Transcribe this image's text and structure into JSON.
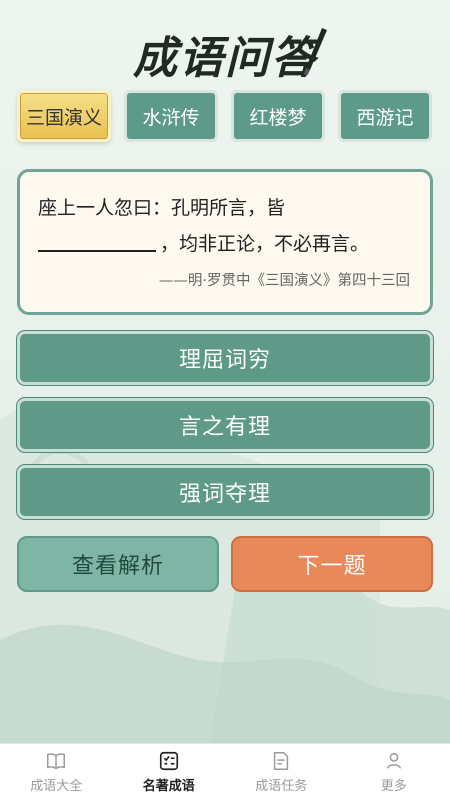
{
  "app": {
    "title": "成语问答"
  },
  "tabs": [
    {
      "label": "三国演义",
      "active": true
    },
    {
      "label": "水浒传",
      "active": false
    },
    {
      "label": "红楼梦",
      "active": false
    },
    {
      "label": "西游记",
      "active": false
    }
  ],
  "question": {
    "line1": "座上一人忽曰：孔明所言，皆",
    "line2_after_blank": "，均非正论，不必再言。",
    "source": "——明·罗贯中《三国演义》第四十三回"
  },
  "options": [
    {
      "label": "理屈词穷"
    },
    {
      "label": "言之有理"
    },
    {
      "label": "强词夺理"
    }
  ],
  "actions": {
    "explain_label": "查看解析",
    "next_label": "下一题"
  },
  "bottom_nav": [
    {
      "label": "成语大全",
      "icon": "book-icon",
      "active": false
    },
    {
      "label": "名著成语",
      "icon": "checklist-icon",
      "active": true
    },
    {
      "label": "成语任务",
      "icon": "document-icon",
      "active": false
    },
    {
      "label": "更多",
      "icon": "user-icon",
      "active": false
    }
  ],
  "colors": {
    "primary": "#5f9a89",
    "gold": "#e8c14f",
    "orange": "#e8895a",
    "background": "#eef3ee"
  }
}
